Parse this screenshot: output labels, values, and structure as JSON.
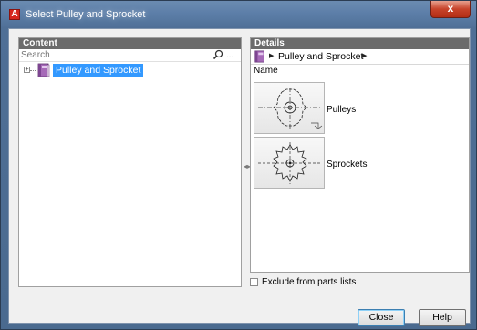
{
  "window": {
    "title": "Select Pulley and Sprocket",
    "close_glyph": "x",
    "app_icon": "autodesk-a-icon"
  },
  "content_panel": {
    "header": "Content",
    "search_placeholder": "Search",
    "search_more": "...",
    "tree": [
      {
        "label": "Pulley and Sprocket",
        "selected": true,
        "expanded": false,
        "icon": "book-icon"
      }
    ]
  },
  "details_panel": {
    "header": "Details",
    "breadcrumb": "Pulley and Sprocket",
    "column_header": "Name",
    "items": [
      {
        "label": "Pulleys",
        "icon": "pulley-icon"
      },
      {
        "label": "Sprockets",
        "icon": "sprocket-icon"
      }
    ]
  },
  "options": {
    "exclude_label": "Exclude from parts lists",
    "exclude_checked": false
  },
  "buttons": {
    "close": "Close",
    "help": "Help"
  },
  "colors": {
    "selection": "#3399ff",
    "panel_header": "#6b6b6b",
    "close_button": "#c7432a"
  }
}
